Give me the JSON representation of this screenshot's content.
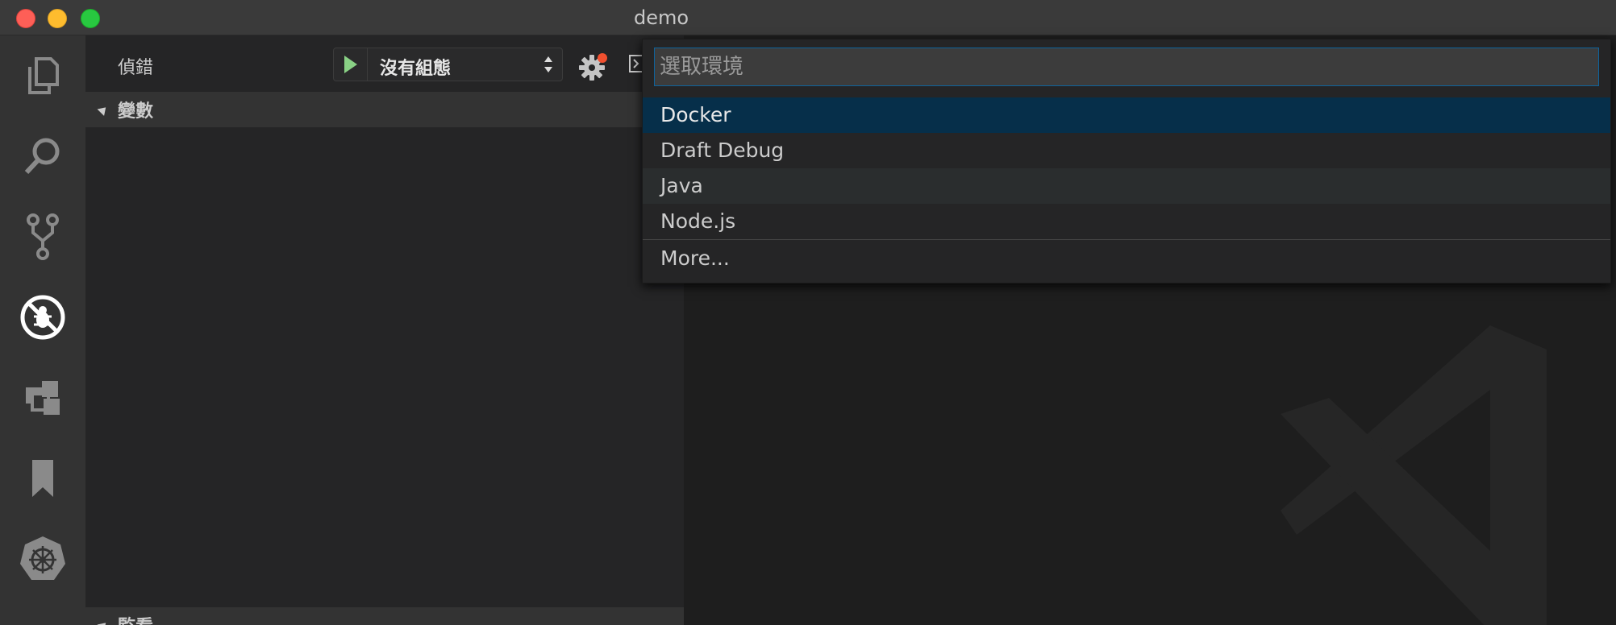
{
  "window": {
    "title": "demo"
  },
  "activity_bar": {
    "items": [
      "explorer-icon",
      "search-icon",
      "source-control-icon",
      "debug-icon",
      "extensions-icon",
      "bookmark-icon",
      "kubernetes-icon"
    ]
  },
  "sidebar": {
    "title": "偵錯",
    "config_label": "沒有組態",
    "sections": {
      "variables": "變數",
      "watch": "監看"
    }
  },
  "quick_pick": {
    "placeholder": "選取環境",
    "items": [
      "Docker",
      "Draft Debug",
      "Java",
      "Node.js"
    ],
    "more": "More..."
  },
  "colors": {
    "accent": "#0e639c",
    "selected": "#062f4a",
    "play": "#89d185",
    "badge": "#f1502f"
  }
}
